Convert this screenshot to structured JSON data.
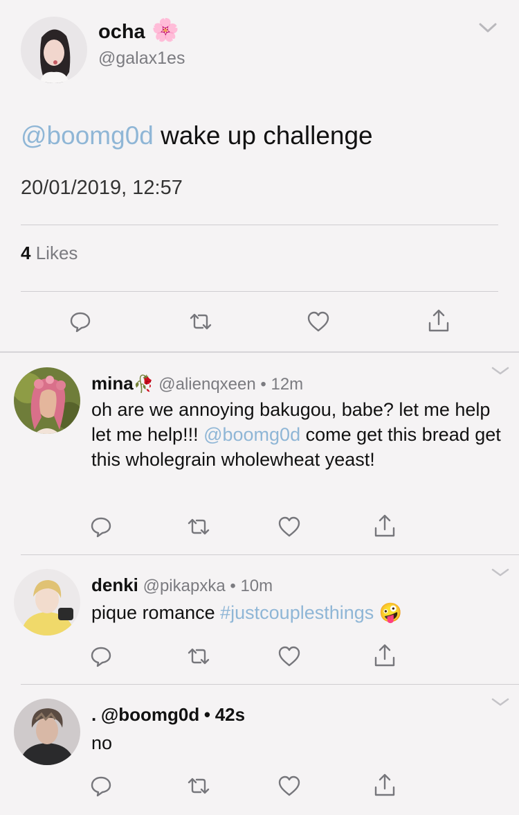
{
  "main_tweet": {
    "name": "ocha",
    "name_emoji": "🌸",
    "handle": "@galax1es",
    "mention": "@boomg0d",
    "text": " wake up challenge",
    "timestamp": "20/01/2019, 12:57",
    "likes_count": "4",
    "likes_label": "Likes"
  },
  "replies": [
    {
      "name": "mina",
      "name_emoji": "🥀",
      "handle": "@alienqxeen",
      "dot": "•",
      "time": "12m",
      "text_before": "oh are we annoying bakugou, babe? let me help let me help!!! ",
      "mention": "@boomg0d",
      "text_after": " come get this bread get this wholegrain wholewheat yeast!"
    },
    {
      "name": "denki",
      "handle": "@pikapxka",
      "dot": "•",
      "time": "10m",
      "text_before": "pique romance ",
      "hashtag": "#justcouplesthings",
      "emoji": "🤪"
    },
    {
      "name": ".",
      "handle": "@boomg0d",
      "dot": "•",
      "time": "42s",
      "text": "no"
    }
  ],
  "icons": [
    "reply-icon",
    "retweet-icon",
    "like-icon",
    "share-icon",
    "chevron-down-icon"
  ],
  "colors": {
    "link": "#8fb6d6",
    "muted": "#7b7b80",
    "background": "#f5f3f4"
  }
}
